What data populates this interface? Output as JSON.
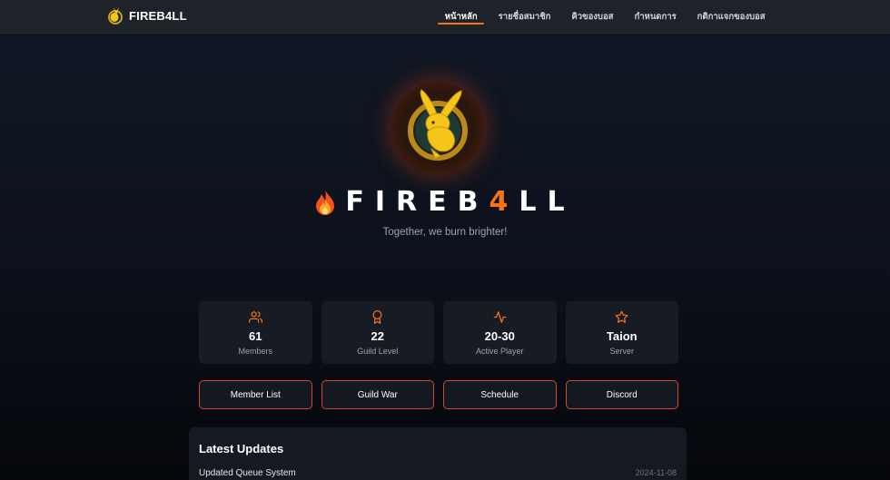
{
  "nav": {
    "brand": "FIREB4LL",
    "links": [
      {
        "label": "หน้าหลัก",
        "active": true
      },
      {
        "label": "รายชื่อสมาชิก",
        "active": false
      },
      {
        "label": "คิวของบอส",
        "active": false
      },
      {
        "label": "กำหนดการ",
        "active": false
      },
      {
        "label": "กติกาแจกของบอส",
        "active": false
      }
    ]
  },
  "hero": {
    "title_prefix": "FIREB",
    "title_accent": "4",
    "title_suffix": "LL",
    "tagline": "Together, we burn brighter!"
  },
  "stats": [
    {
      "icon": "users-icon",
      "value": "61",
      "label": "Members"
    },
    {
      "icon": "award-icon",
      "value": "22",
      "label": "Guild Level"
    },
    {
      "icon": "activity-icon",
      "value": "20-30",
      "label": "Active Player"
    },
    {
      "icon": "star-icon",
      "value": "Taion",
      "label": "Server"
    }
  ],
  "actions": [
    "Member List",
    "Guild War",
    "Schedule",
    "Discord"
  ],
  "updates": {
    "title": "Latest Updates",
    "items": [
      {
        "text": "Updated Queue System",
        "date": "2024-11-08"
      }
    ]
  },
  "colors": {
    "accent": "#f97316",
    "button_border": "#d9452b",
    "card_bg": "#161b24",
    "nav_bg": "#1e2229"
  }
}
